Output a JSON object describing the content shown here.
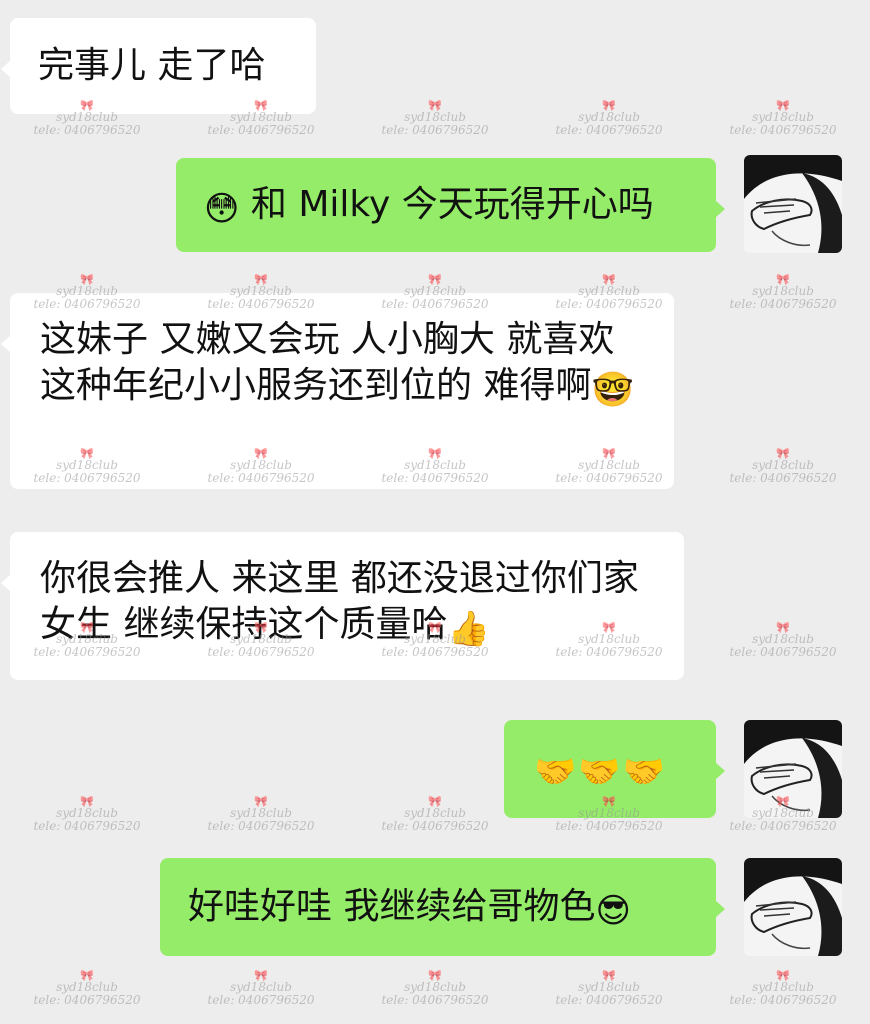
{
  "messages": [
    {
      "side": "in",
      "text": "完事儿 走了哈",
      "emoji": "",
      "emoji_name": ""
    },
    {
      "side": "out",
      "text": "和 Milky 今天玩得开心吗",
      "emoji": "😳",
      "emoji_name": "flushed-face-icon"
    },
    {
      "side": "in",
      "text": "这妹子 又嫩又会玩 人小胸大 就喜欢这种年纪小小服务还到位的 难得啊",
      "emoji": "🤓",
      "emoji_name": "666-emoji-icon"
    },
    {
      "side": "in",
      "text": "你很会推人 来这里 都还没退过你们家女生 继续保持这个质量哈",
      "emoji": "👍",
      "emoji_name": "thumbs-up-icon"
    },
    {
      "side": "out",
      "text": "",
      "emoji": "🤝🤝🤝",
      "emoji_name": "handshake-icon"
    },
    {
      "side": "out",
      "text": "好哇好哇 我继续给哥物色",
      "emoji": "😎",
      "emoji_name": "sunglasses-face-icon"
    }
  ],
  "watermark": {
    "line1": "syd18club",
    "line2": "tele: 0406796520",
    "bow": "🎀"
  },
  "colors": {
    "background": "#ededed",
    "incoming_bubble": "#ffffff",
    "outgoing_bubble": "#95ec69"
  }
}
